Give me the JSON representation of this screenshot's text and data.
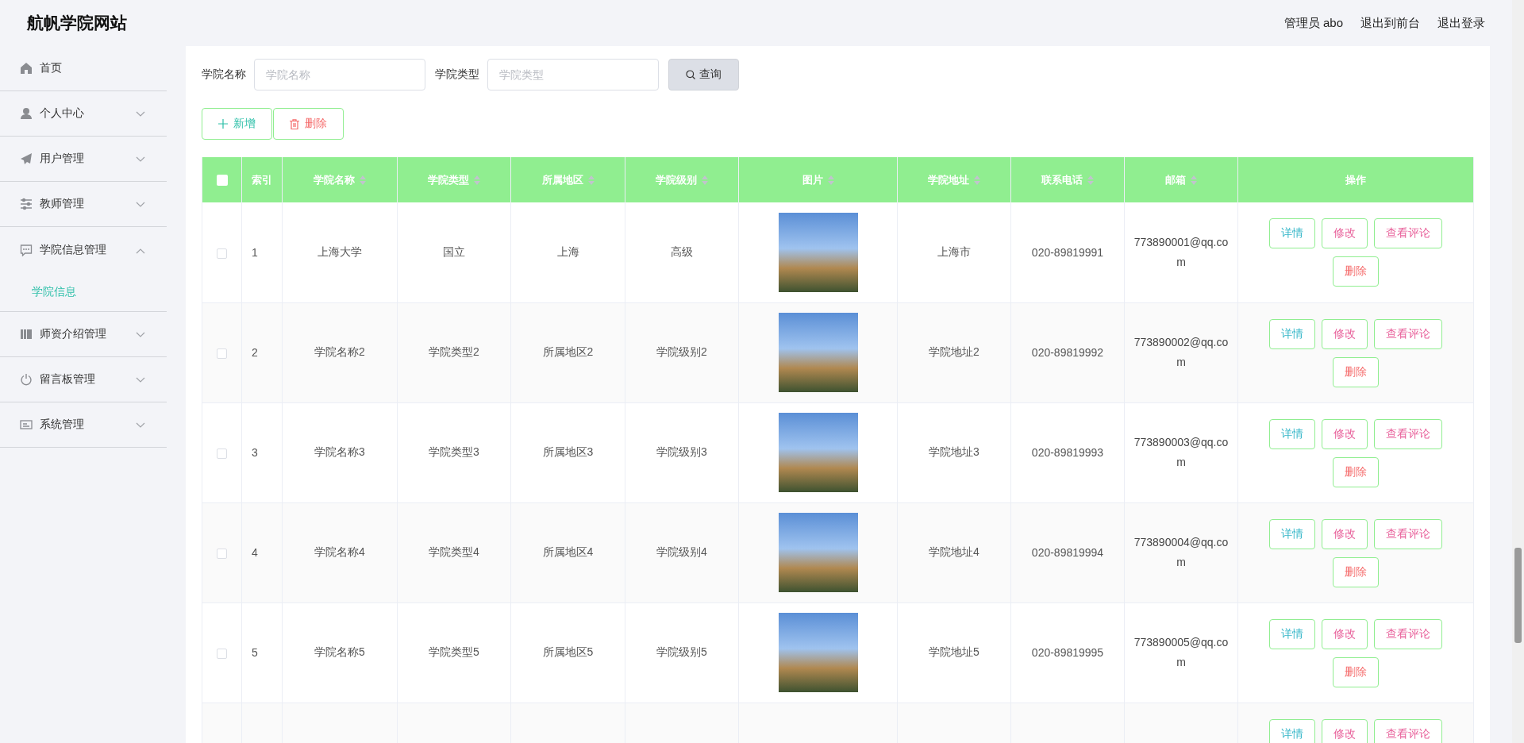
{
  "header": {
    "site_title": "航帆学院网站",
    "links": [
      "管理员 abo",
      "退出到前台",
      "退出登录"
    ]
  },
  "sidebar": {
    "items": [
      {
        "label": "首页",
        "kind": "link"
      },
      {
        "label": "个人中心",
        "kind": "menu",
        "expanded": false
      },
      {
        "label": "用户管理",
        "kind": "menu",
        "expanded": false
      },
      {
        "label": "教师管理",
        "kind": "menu",
        "expanded": false
      },
      {
        "label": "学院信息管理",
        "kind": "menu",
        "expanded": true,
        "children": [
          {
            "label": "学院信息",
            "selected": true
          }
        ]
      },
      {
        "label": "师资介绍管理",
        "kind": "menu",
        "expanded": false
      },
      {
        "label": "留言板管理",
        "kind": "menu",
        "expanded": false
      },
      {
        "label": "系统管理",
        "kind": "menu",
        "expanded": false
      }
    ]
  },
  "search": {
    "fields": [
      {
        "label": "学院名称",
        "placeholder": "学院名称"
      },
      {
        "label": "学院类型",
        "placeholder": "学院类型"
      }
    ],
    "button": "查询"
  },
  "toolbar": [
    {
      "label": "新增",
      "kind": "add"
    },
    {
      "label": "删除",
      "kind": "delete"
    }
  ],
  "table": {
    "select_all": {
      "checked": false
    },
    "columns": [
      {
        "label": "索引",
        "sortable": false
      },
      {
        "label": "学院名称",
        "sortable": true
      },
      {
        "label": "学院类型",
        "sortable": true
      },
      {
        "label": "所属地区",
        "sortable": true
      },
      {
        "label": "学院级别",
        "sortable": true
      },
      {
        "label": "图片",
        "sortable": true
      },
      {
        "label": "学院地址",
        "sortable": true
      },
      {
        "label": "联系电话",
        "sortable": true
      },
      {
        "label": "邮箱",
        "sortable": true
      },
      {
        "label": "操作",
        "sortable": false
      }
    ],
    "rows": [
      {
        "checked": false,
        "cells": [
          "1",
          "上海大学",
          "国立",
          "上海",
          "高级",
          null,
          "上海市",
          "020-89819991",
          "773890001@qq.com"
        ],
        "actions": [
          {
            "label": "详情",
            "kind": "detail"
          },
          {
            "label": "修改",
            "kind": "edit"
          },
          {
            "label": "查看评论",
            "kind": "comment"
          },
          {
            "label": "删除",
            "kind": "delete"
          }
        ]
      },
      {
        "checked": false,
        "cells": [
          "2",
          "学院名称2",
          "学院类型2",
          "所属地区2",
          "学院级别2",
          null,
          "学院地址2",
          "020-89819992",
          "773890002@qq.com"
        ],
        "actions": [
          {
            "label": "详情",
            "kind": "detail"
          },
          {
            "label": "修改",
            "kind": "edit"
          },
          {
            "label": "查看评论",
            "kind": "comment"
          },
          {
            "label": "删除",
            "kind": "delete"
          }
        ]
      },
      {
        "checked": false,
        "cells": [
          "3",
          "学院名称3",
          "学院类型3",
          "所属地区3",
          "学院级别3",
          null,
          "学院地址3",
          "020-89819993",
          "773890003@qq.com"
        ],
        "actions": [
          {
            "label": "详情",
            "kind": "detail"
          },
          {
            "label": "修改",
            "kind": "edit"
          },
          {
            "label": "查看评论",
            "kind": "comment"
          },
          {
            "label": "删除",
            "kind": "delete"
          }
        ]
      },
      {
        "checked": false,
        "cells": [
          "4",
          "学院名称4",
          "学院类型4",
          "所属地区4",
          "学院级别4",
          null,
          "学院地址4",
          "020-89819994",
          "773890004@qq.com"
        ],
        "actions": [
          {
            "label": "详情",
            "kind": "detail"
          },
          {
            "label": "修改",
            "kind": "edit"
          },
          {
            "label": "查看评论",
            "kind": "comment"
          },
          {
            "label": "删除",
            "kind": "delete"
          }
        ]
      },
      {
        "checked": false,
        "cells": [
          "5",
          "学院名称5",
          "学院类型5",
          "所属地区5",
          "学院级别5",
          null,
          "学院地址5",
          "020-89819995",
          "773890005@qq.com"
        ],
        "actions": [
          {
            "label": "详情",
            "kind": "detail"
          },
          {
            "label": "修改",
            "kind": "edit"
          },
          {
            "label": "查看评论",
            "kind": "comment"
          },
          {
            "label": "删除",
            "kind": "delete"
          }
        ]
      },
      {
        "cells": [
          null,
          null,
          null,
          null,
          null,
          null,
          null,
          null,
          null
        ],
        "actions": [
          {
            "label": "详情",
            "kind": "detail"
          },
          {
            "label": "修改",
            "kind": "edit"
          },
          {
            "label": "查看评论",
            "kind": "comment"
          }
        ]
      }
    ]
  }
}
